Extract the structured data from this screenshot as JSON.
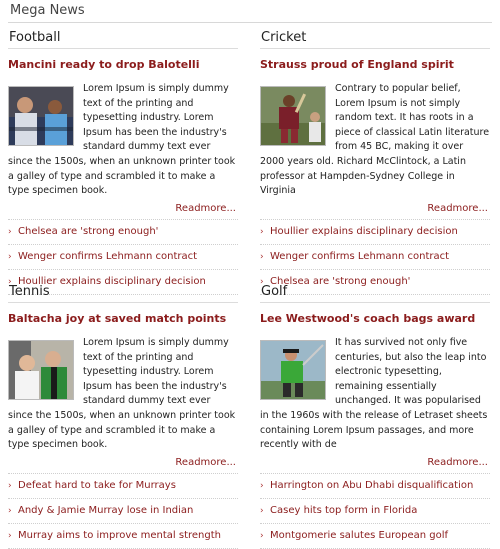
{
  "header": {
    "title": "Mega News"
  },
  "panels": [
    {
      "category": "Football",
      "headline": "Mancini ready to drop Balotelli",
      "body": "Lorem Ipsum is simply dummy text of the printing and typesetting industry. Lorem Ipsum has been the industry's standard dummy text ever since the 1500s, when an unknown printer took a galley of type and scrambled it to make a type specimen book.",
      "readmore": "Readmore...",
      "links": [
        "Chelsea are 'strong enough'",
        "Wenger confirms Lehmann contract",
        "Houllier explains disciplinary decision"
      ],
      "arrow_icon": "chevron-right-icon"
    },
    {
      "category": "Cricket",
      "headline": "Strauss proud of England spirit",
      "body": "Contrary to popular belief, Lorem Ipsum is not simply random text. It has roots in a piece of classical Latin literature from 45 BC, making it over 2000 years old. Richard McClintock, a Latin professor at Hampden-Sydney College in Virginia",
      "readmore": "Readmore...",
      "links": [
        "Houllier explains disciplinary decision",
        "Wenger confirms Lehmann contract",
        "Chelsea are 'strong enough'"
      ],
      "arrow_icon": "chevron-right-icon"
    },
    {
      "category": "Tennis",
      "headline": "Baltacha joy at saved match points",
      "body": "Lorem Ipsum is simply dummy text of the printing and typesetting industry. Lorem Ipsum has been the industry's standard dummy text ever since the 1500s, when an unknown printer took a galley of type and scrambled it to make a type specimen book.",
      "readmore": "Readmore...",
      "links": [
        "Defeat hard to take for Murrays",
        "Andy & Jamie Murray lose in Indian",
        "Murray aims to improve mental strength"
      ],
      "arrow_icon": "chevron-right-icon"
    },
    {
      "category": "Golf",
      "headline": "Lee Westwood's coach bags award",
      "body": "It has survived not only five centuries, but also the leap into electronic typesetting, remaining essentially unchanged. It was popularised in the 1960s with the release of Letraset sheets containing Lorem Ipsum passages, and more recently with de",
      "readmore": "Readmore...",
      "links": [
        "Harrington on Abu Dhabi disqualification",
        "Casey hits top form in Florida",
        "Montgomerie salutes European golf"
      ],
      "arrow_icon": "chevron-right-icon"
    }
  ],
  "colors": {
    "headline": "#8b1c1c",
    "divider": "#d8d8d8"
  }
}
